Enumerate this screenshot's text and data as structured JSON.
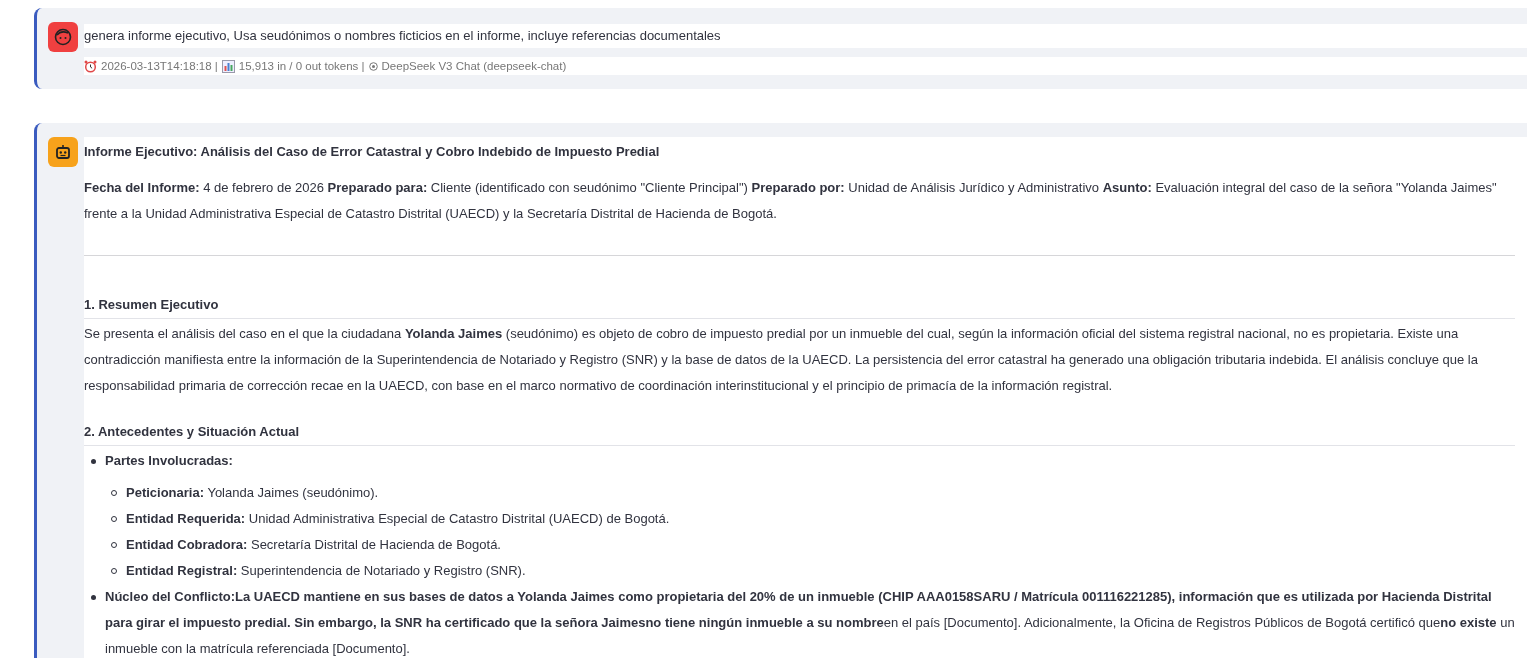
{
  "user_message": {
    "text": "genera informe ejecutivo, Usa seudónimos o nombres ficticios en el informe, incluye referencias documentales",
    "timestamp": "2026-03-13T14:18:18 |",
    "tokens": "15,913 in / 0 out tokens |",
    "model": "DeepSeek V3 Chat (deepseek-chat)"
  },
  "assistant_message": {
    "blocks": [
      {
        "kind": "title",
        "text": "Informe Ejecutivo: Análisis del Caso de Error Catastral y Cobro Indebido de Impuesto Predial"
      },
      {
        "kind": "paragraph",
        "text": "**Fecha del Informe:** 4 de febrero de 2026 **Preparado para:** Cliente (identificado con seudónimo \"Cliente Principal\") **Preparado por:** Unidad de Análisis Jurídico y Administrativo **Asunto:** Evaluación integral del caso de la señora \"Yolanda Jaimes\" frente a la Unidad Administrativa Especial de Catastro Distrital (UAECD) y la Secretaría Distrital de Hacienda de Bogotá."
      },
      {
        "kind": "rule"
      },
      {
        "kind": "heading",
        "text": "1. Resumen Ejecutivo"
      },
      {
        "kind": "paragraph",
        "text": "Se presenta el análisis del caso en el que la ciudadana **Yolanda Jaimes** (seudónimo) es objeto de cobro de impuesto predial por un inmueble del cual, según la información oficial del sistema registral nacional, no es propietaria. Existe una contradicción manifiesta entre la información de la Superintendencia de Notariado y Registro (SNR) y la base de datos de la UAECD. La persistencia del error catastral ha generado una obligación tributaria indebida. El análisis concluye que la responsabilidad primaria de corrección recae en la UAECD, con base en el marco normativo de coordinación interinstitucional y el principio de primacía de la información registral."
      },
      {
        "kind": "heading",
        "text": "2. Antecedentes y Situación Actual"
      },
      {
        "kind": "list",
        "items": [
          {
            "text": "**Partes Involucradas:**",
            "children": [
              {
                "text": "**Peticionaria:** Yolanda Jaimes (seudónimo)."
              },
              {
                "text": "**Entidad Requerida:** Unidad Administrativa Especial de Catastro Distrital (UAECD) de Bogotá."
              },
              {
                "text": "**Entidad Cobradora:** Secretaría Distrital de Hacienda de Bogotá."
              },
              {
                "text": "**Entidad Registral:** Superintendencia de Notariado y Registro (SNR)."
              }
            ]
          },
          {
            "text": "**Núcleo del Conflicto:La UAECD mantiene en sus bases de datos a Yolanda Jaimes como propietaria del 20% de un inmueble (CHIP AAA0158SARU / Matrícula 001116221285), información que es utilizada por Hacienda Distrital para girar el impuesto predial. Sin embargo, la SNR ha certificado que la señora Jaimesno tiene ningún inmueble a su nombre**en el país [Documento]. Adicionalmente, la Oficina de Registros Públicos de Bogotá certificó que**no existe** un inmueble con la matrícula referenciada [Documento]."
          }
        ]
      }
    ]
  }
}
